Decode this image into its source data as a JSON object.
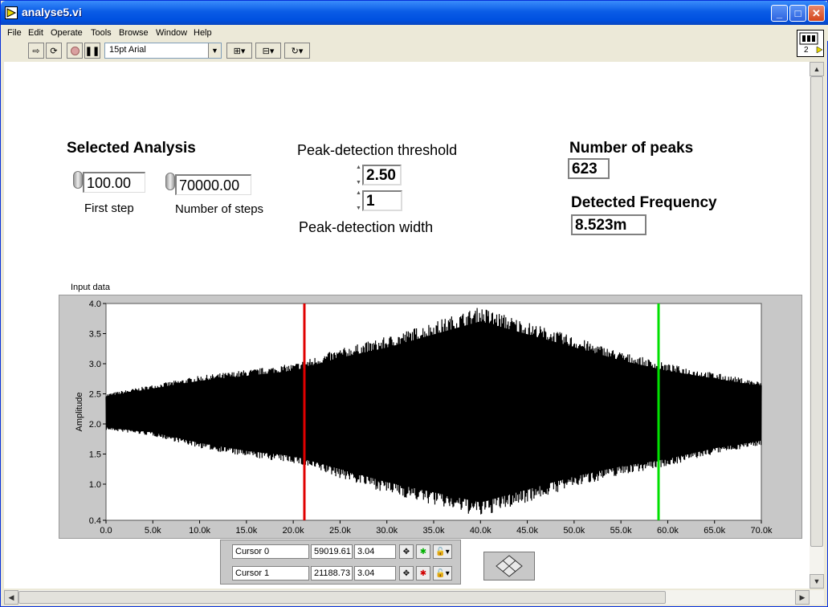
{
  "window": {
    "title": "analyse5.vi",
    "min": "_",
    "max": "□",
    "close": "✕"
  },
  "menu": [
    "File",
    "Edit",
    "Operate",
    "Tools",
    "Browse",
    "Window",
    "Help"
  ],
  "toolbar": {
    "font": "15pt Arial",
    "vi_icon_label": "2"
  },
  "controls": {
    "selected_analysis": "Selected Analysis",
    "first_step_value": "100.00",
    "first_step_label": "First step",
    "num_steps_value": "70000.00",
    "num_steps_label": "Number of steps",
    "threshold_label": "Peak-detection threshold",
    "threshold_value": "2.50",
    "width_value": "1",
    "width_label": "Peak-detection width",
    "num_peaks_label": "Number of peaks",
    "num_peaks_value": "623",
    "freq_label": "Detected Frequency",
    "freq_value": "8.523m"
  },
  "chart_data": {
    "type": "line",
    "title": "Input data",
    "xlabel": "",
    "ylabel": "Amplitude",
    "xlim": [
      0,
      70000
    ],
    "ylim": [
      0.4,
      4.0
    ],
    "xticks": [
      "0.0",
      "5.0k",
      "10.0k",
      "15.0k",
      "20.0k",
      "25.0k",
      "30.0k",
      "35.0k",
      "40.0k",
      "45.0k",
      "50.0k",
      "55.0k",
      "60.0k",
      "65.0k",
      "70.0k"
    ],
    "yticks": [
      "4.0",
      "3.5",
      "3.0",
      "2.5",
      "2.0",
      "1.5",
      "1.0",
      "0.4"
    ],
    "envelope": {
      "x": [
        0,
        5000,
        10000,
        15000,
        20000,
        25000,
        30000,
        35000,
        40000,
        45000,
        50000,
        55000,
        60000,
        65000,
        70000
      ],
      "upper": [
        2.5,
        2.65,
        2.8,
        2.9,
        3.0,
        3.25,
        3.45,
        3.7,
        3.95,
        3.7,
        3.45,
        3.2,
        3.0,
        2.85,
        2.7
      ],
      "lower": [
        1.9,
        1.8,
        1.6,
        1.45,
        1.35,
        1.1,
        0.85,
        0.65,
        0.45,
        0.7,
        0.95,
        1.15,
        1.3,
        1.5,
        1.65
      ]
    },
    "cursors": [
      {
        "name": "Cursor 0",
        "x": 59019.61,
        "y": 3.04,
        "color": "#00e000"
      },
      {
        "name": "Cursor 1",
        "x": 21188.73,
        "y": 3.04,
        "color": "#e00000"
      }
    ],
    "grid": false
  },
  "cursor_table": [
    {
      "name": "Cursor 0",
      "x": "59019.61",
      "y": "3.04"
    },
    {
      "name": "Cursor 1",
      "x": "21188.73",
      "y": "3.04"
    }
  ]
}
